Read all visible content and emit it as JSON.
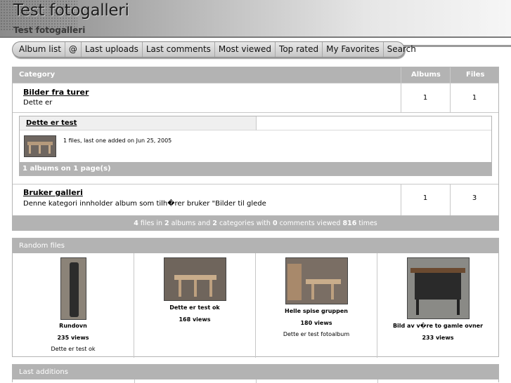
{
  "header": {
    "title": "Test fotogalleri",
    "subtitle": "Test fotogalleri"
  },
  "menu": [
    "Album list",
    "@",
    "Last uploads",
    "Last comments",
    "Most viewed",
    "Top rated",
    "My Favorites",
    "Search"
  ],
  "categories": {
    "columns": {
      "category": "Category",
      "albums": "Albums",
      "files": "Files"
    },
    "rows": [
      {
        "name": "Bilder fra turer",
        "description": "Dette er",
        "albums": "1",
        "files": "1"
      },
      {
        "name": "Bruker galleri",
        "description": "Denne kategori innholder album som tilh�rer bruker \"Bilder til glede",
        "albums": "1",
        "files": "3"
      }
    ],
    "album": {
      "name": "Dette er test",
      "info": "1 files, last one added on Jun 25, 2005",
      "pages": "1 albums on 1 page(s)"
    }
  },
  "stats": {
    "files": "4",
    "t1": " files in ",
    "albums": "2",
    "t2": " albums and ",
    "categories": "2",
    "t3": " categories with ",
    "comments": "0",
    "t4": " comments viewed ",
    "views": "816",
    "t5": " times"
  },
  "random_files": {
    "heading": "Random files",
    "items": [
      {
        "title": "Rundovn",
        "views": "235 views",
        "description": "Dette er test ok"
      },
      {
        "title": "Dette er test ok",
        "views": "168 views",
        "description": ""
      },
      {
        "title": "Helle spise gruppen",
        "views": "180 views",
        "description": "Dette er test fotoalbum"
      },
      {
        "title": "Bild av v�re to gamle ovner",
        "views": "233 views",
        "description": ""
      }
    ]
  },
  "last_additions": {
    "heading": "Last additions"
  }
}
